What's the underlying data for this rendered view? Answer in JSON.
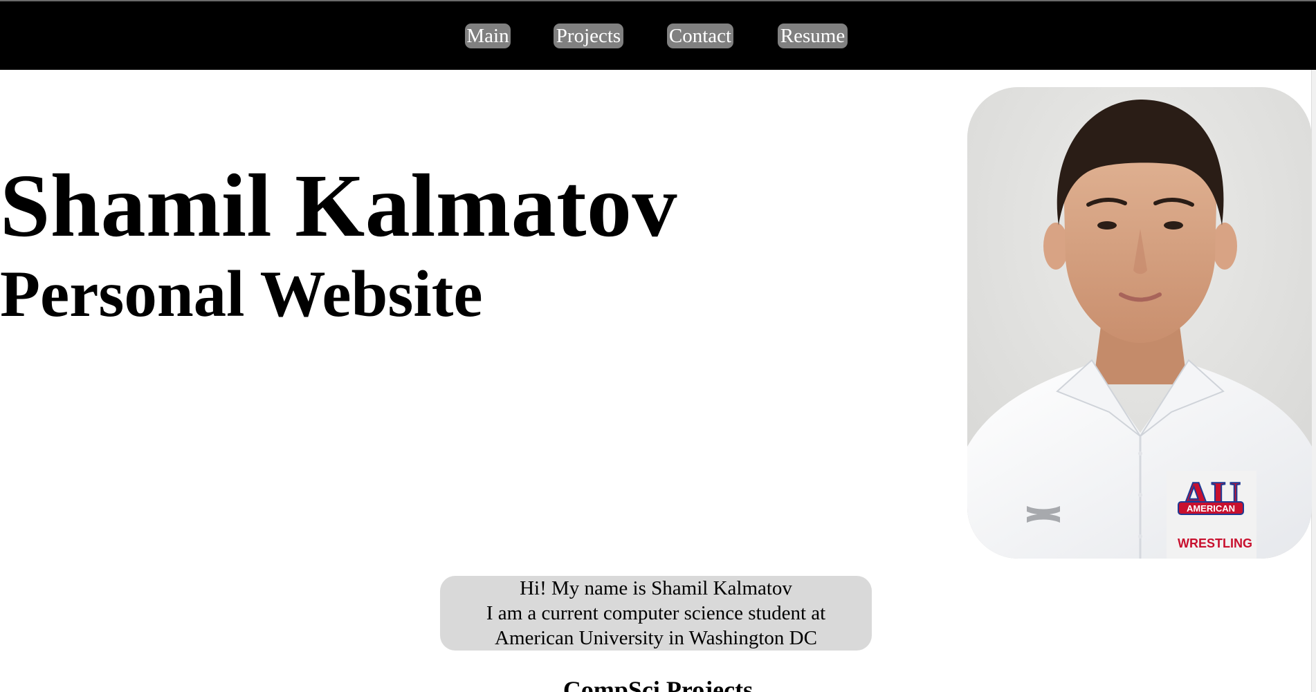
{
  "nav": {
    "items": [
      {
        "label": "Main"
      },
      {
        "label": "Projects"
      },
      {
        "label": "Contact"
      },
      {
        "label": "Resume"
      }
    ]
  },
  "hero": {
    "title": "Shamil Kalmatov",
    "subtitle": "Personal Website",
    "photo_logo_text": "AMERICAN",
    "photo_logo_letters": "AU",
    "photo_wrestling_text": "WRESTLING"
  },
  "intro": {
    "lines": [
      "Hi! My name is Shamil Kalmatov",
      "I am a current computer science student at",
      "American University in Washington DC"
    ]
  },
  "sections": {
    "projects_heading": "CompSci Projects"
  },
  "colors": {
    "navbar": "#000000",
    "nav_button": "#808080",
    "intro_box": "#d9d9d9",
    "logo_red": "#c8102e",
    "logo_blue": "#1f3a93"
  }
}
